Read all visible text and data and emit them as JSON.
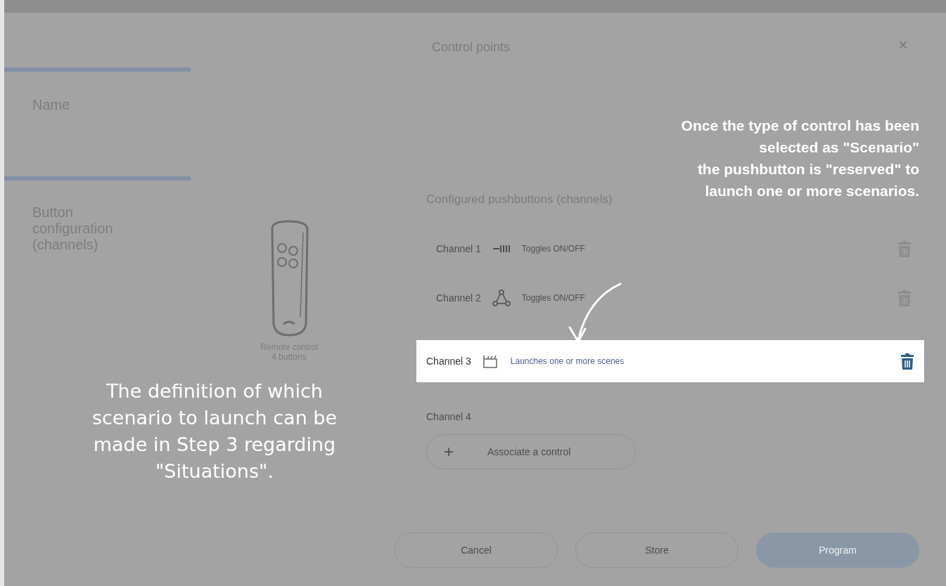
{
  "dialog": {
    "title": "Control points",
    "close_glyph": "×"
  },
  "name_section": {
    "label": "Name"
  },
  "button_section": {
    "label": "Button configuration (channels)",
    "device_caption": "Remote control 4 buttons"
  },
  "channels": {
    "heading": "Configured pushbuttons (channels)",
    "items": [
      {
        "kind": "assigned",
        "label": "Channel 1",
        "description": "Toggles ON/OFF",
        "highlighted": false
      },
      {
        "kind": "assigned",
        "label": "Channel 2",
        "description": "Toggles ON/OFF",
        "highlighted": false
      },
      {
        "kind": "assigned",
        "label": "Channel 3",
        "description": "Launches one or more scenes",
        "highlighted": true
      },
      {
        "kind": "empty",
        "label": "Channel 4",
        "plus_glyph": "+",
        "action": "Associate a control"
      }
    ]
  },
  "buttons": [
    {
      "label": "Cancel",
      "primary": false
    },
    {
      "label": "Store",
      "primary": false
    },
    {
      "label": "Program",
      "primary": true
    }
  ],
  "annotations": [
    {
      "kind": "right",
      "text": "Once the type of control has been\nselected as \"Scenario\"\nthe pushbutton is \"reserved\" to\nlaunch one or more scenarios."
    },
    {
      "kind": "left",
      "text": "The definition of which\nscenario to launch can be\nmade in Step 3 regarding\n\"Situations\"."
    }
  ]
}
